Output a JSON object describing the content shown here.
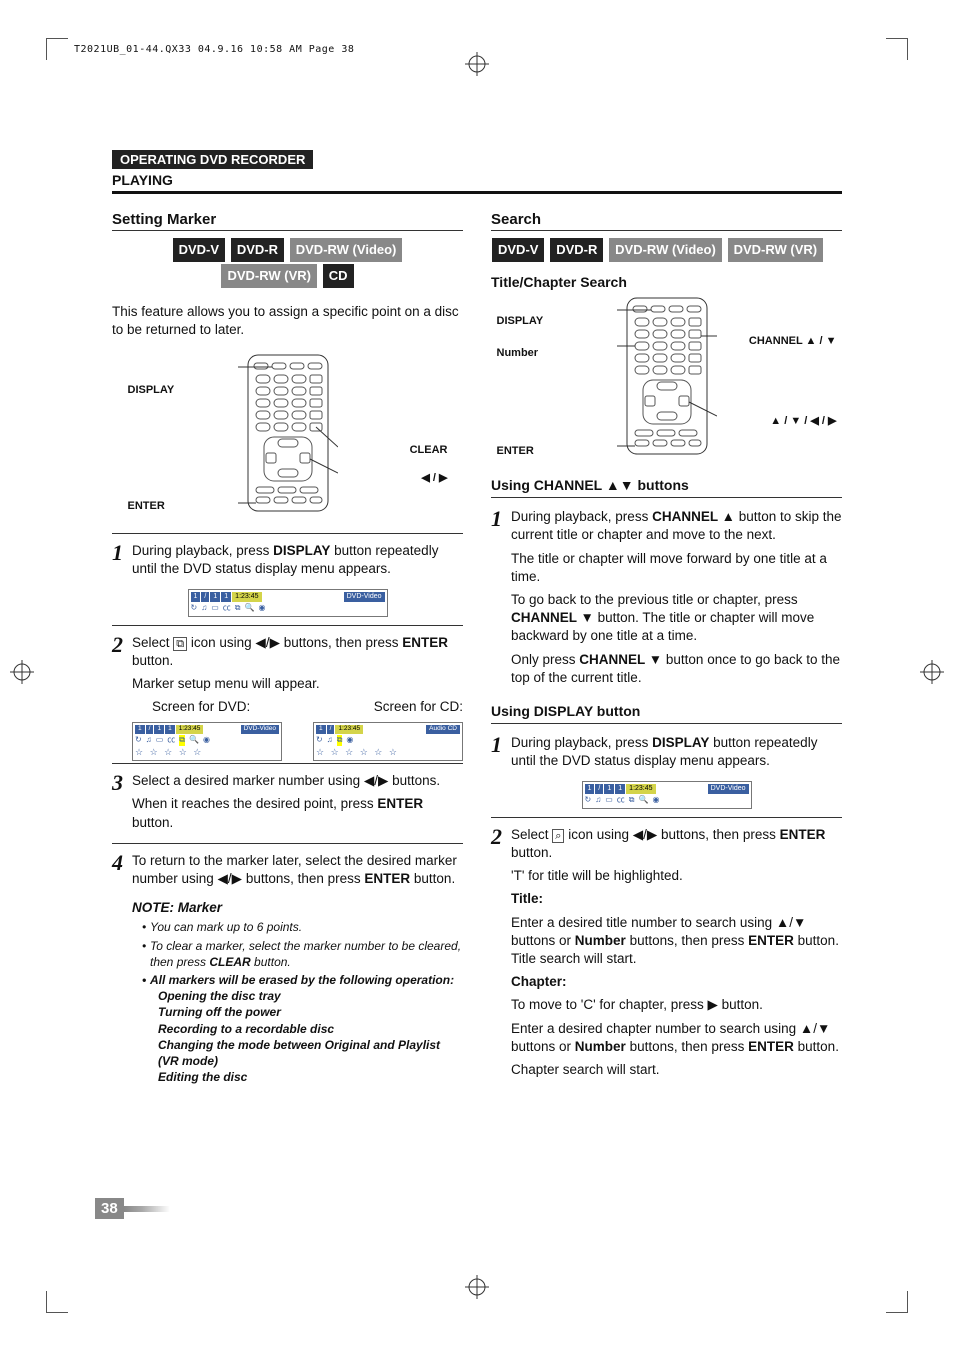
{
  "meta": {
    "print_header": "T2021UB_01-44.QX33  04.9.16  10:58 AM  Page 38"
  },
  "header": {
    "chip": "OPERATING DVD RECORDER",
    "subhead": "PLAYING"
  },
  "left": {
    "section_title": "Setting Marker",
    "badges": [
      "DVD-V",
      "DVD-R",
      "DVD-RW (Video)",
      "DVD-RW (VR)",
      "CD"
    ],
    "intro": "This feature allows you to assign a specific point on a disc to be returned to later.",
    "remote_labels": {
      "display": "DISPLAY",
      "enter": "ENTER",
      "clear": "CLEAR",
      "leftright": "◀ / ▶"
    },
    "step1_a": "During playback, press ",
    "step1_b": "DISPLAY",
    "step1_c": " button repeatedly until the DVD status display menu appears.",
    "osd1": {
      "seg1": "1",
      "seg2": "/",
      "seg3": "1",
      "seg4": "1",
      "time": "1:23:45",
      "tag": "DVD-Video"
    },
    "step2_a": "Select ",
    "step2_icon": "marker-icon",
    "step2_b": " icon using ◀/▶ buttons, then press ",
    "step2_c": "ENTER",
    "step2_d": " button.",
    "step2_e": "Marker setup menu will appear.",
    "screen_dvd_label": "Screen for DVD:",
    "screen_cd_label": "Screen for CD:",
    "osd_dvd": {
      "time": "1:23:45",
      "tag": "DVD-Video"
    },
    "osd_cd": {
      "time": "1:23:45",
      "tag": "Audio CD"
    },
    "stars": "☆ ☆ ☆ ☆ ☆",
    "step3_a": "Select a desired marker number using ◀/▶ buttons.",
    "step3_b": "When it reaches the desired point, press ",
    "step3_c": "ENTER",
    "step3_d": " button.",
    "step4_a": "To return to the marker later, select the desired marker number using ◀/▶ buttons, then press ",
    "step4_b": "ENTER",
    "step4_c": " button.",
    "note_title": "NOTE: Marker",
    "note_items": [
      "You can mark up to 6 points.",
      "To clear a marker, select the marker number to be cleared, then press <b>CLEAR</b> button.",
      "All markers will be erased by the following operation:"
    ],
    "note_sublist": [
      "Opening the disc tray",
      "Turning off the power",
      "Recording to a recordable disc",
      "Changing the mode between Original and Playlist  (VR mode)",
      "Editing the disc"
    ]
  },
  "right": {
    "section_title": "Search",
    "badges": [
      "DVD-V",
      "DVD-R",
      "DVD-RW (Video)",
      "DVD-RW (VR)"
    ],
    "tcs_title": "Title/Chapter Search",
    "remote_labels": {
      "display": "DISPLAY",
      "number": "Number",
      "enter": "ENTER",
      "channel": "CHANNEL ▲ / ▼",
      "arrows": "▲ / ▼ / ◀ / ▶"
    },
    "use_channel_title": "Using CHANNEL ▲▼ buttons",
    "c1_a": "During playback, press ",
    "c1_b": "CHANNEL ▲",
    "c1_c": " button to skip the current title or chapter and move to the next.",
    "c1_d": "The title or chapter will move forward by one title at a time.",
    "c1_e": "To go back to the previous title or chapter, press ",
    "c1_f": "CHANNEL ▼",
    "c1_g": " button. The title or chapter will move backward by one title at a time.",
    "c1_h": "Only press ",
    "c1_i": "CHANNEL ▼",
    "c1_j": " button once to go back to the top of the current title.",
    "use_display_title": "Using DISPLAY button",
    "d1_a": "During playback, press ",
    "d1_b": "DISPLAY",
    "d1_c": " button repeatedly until the DVD status display menu appears.",
    "osd2": {
      "time": "1:23:45",
      "tag": "DVD-Video"
    },
    "d2_a": "Select ",
    "d2_icon": "search-icon",
    "d2_b": " icon using ◀/▶ buttons, then press ",
    "d2_c": "ENTER",
    "d2_d": " button.",
    "d2_e": "'T' for title will be highlighted.",
    "title_label": "Title:",
    "title_text_a": "Enter a desired title number to search using ▲/▼ buttons or ",
    "title_text_b": "Number",
    "title_text_c": " buttons, then press ",
    "title_text_d": "ENTER",
    "title_text_e": " button. Title search will start.",
    "chapter_label": "Chapter:",
    "chapter_text_a": "To move to 'C' for chapter, press ▶ button.",
    "chapter_text_b": "Enter a desired chapter number to search using ▲/▼ buttons or ",
    "chapter_text_c": "Number",
    "chapter_text_d": " buttons, then press ",
    "chapter_text_e": "ENTER",
    "chapter_text_f": " button.",
    "chapter_text_g": "Chapter search will start."
  },
  "page_number": "38"
}
